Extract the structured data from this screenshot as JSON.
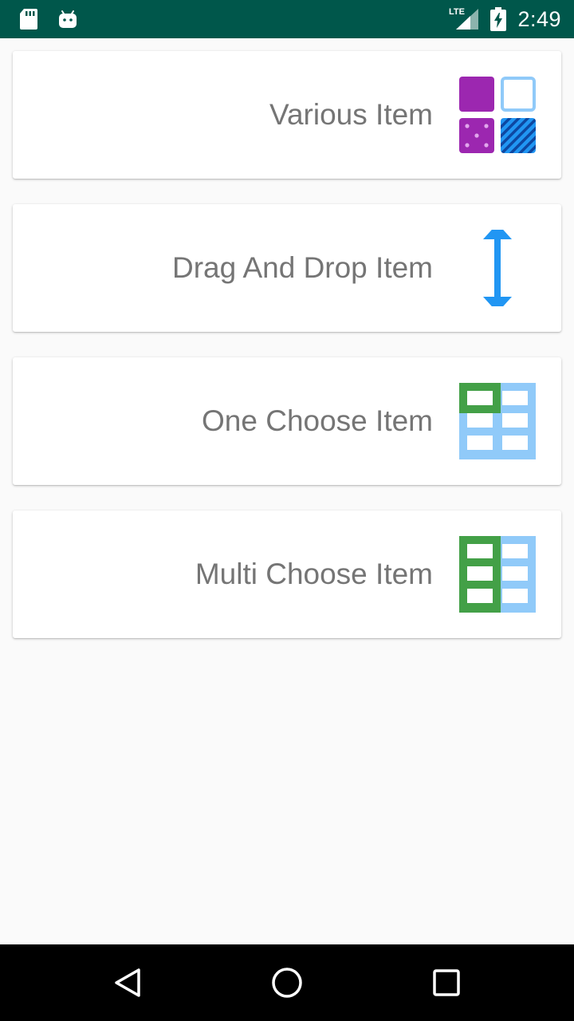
{
  "status_bar": {
    "time": "2:49",
    "network_label": "LTE",
    "icons": [
      "sd-card-icon",
      "android-icon",
      "lte-signal-icon",
      "battery-charging-icon"
    ]
  },
  "menu_items": [
    {
      "label": "Various Item",
      "icon": "various-grid-icon"
    },
    {
      "label": "Drag And Drop Item",
      "icon": "drag-vertical-arrow-icon"
    },
    {
      "label": "One Choose Item",
      "icon": "single-select-table-icon"
    },
    {
      "label": "Multi Choose Item",
      "icon": "multi-select-table-icon"
    }
  ],
  "nav_bar": {
    "buttons": [
      "back-icon",
      "home-icon",
      "recents-icon"
    ]
  },
  "colors": {
    "status_bar": "#00574b",
    "purple": "#9c27b0",
    "light_blue": "#90caf9",
    "blue": "#2196f3",
    "dark_blue": "#1565c0",
    "green": "#43a047",
    "label_gray": "#757575"
  }
}
